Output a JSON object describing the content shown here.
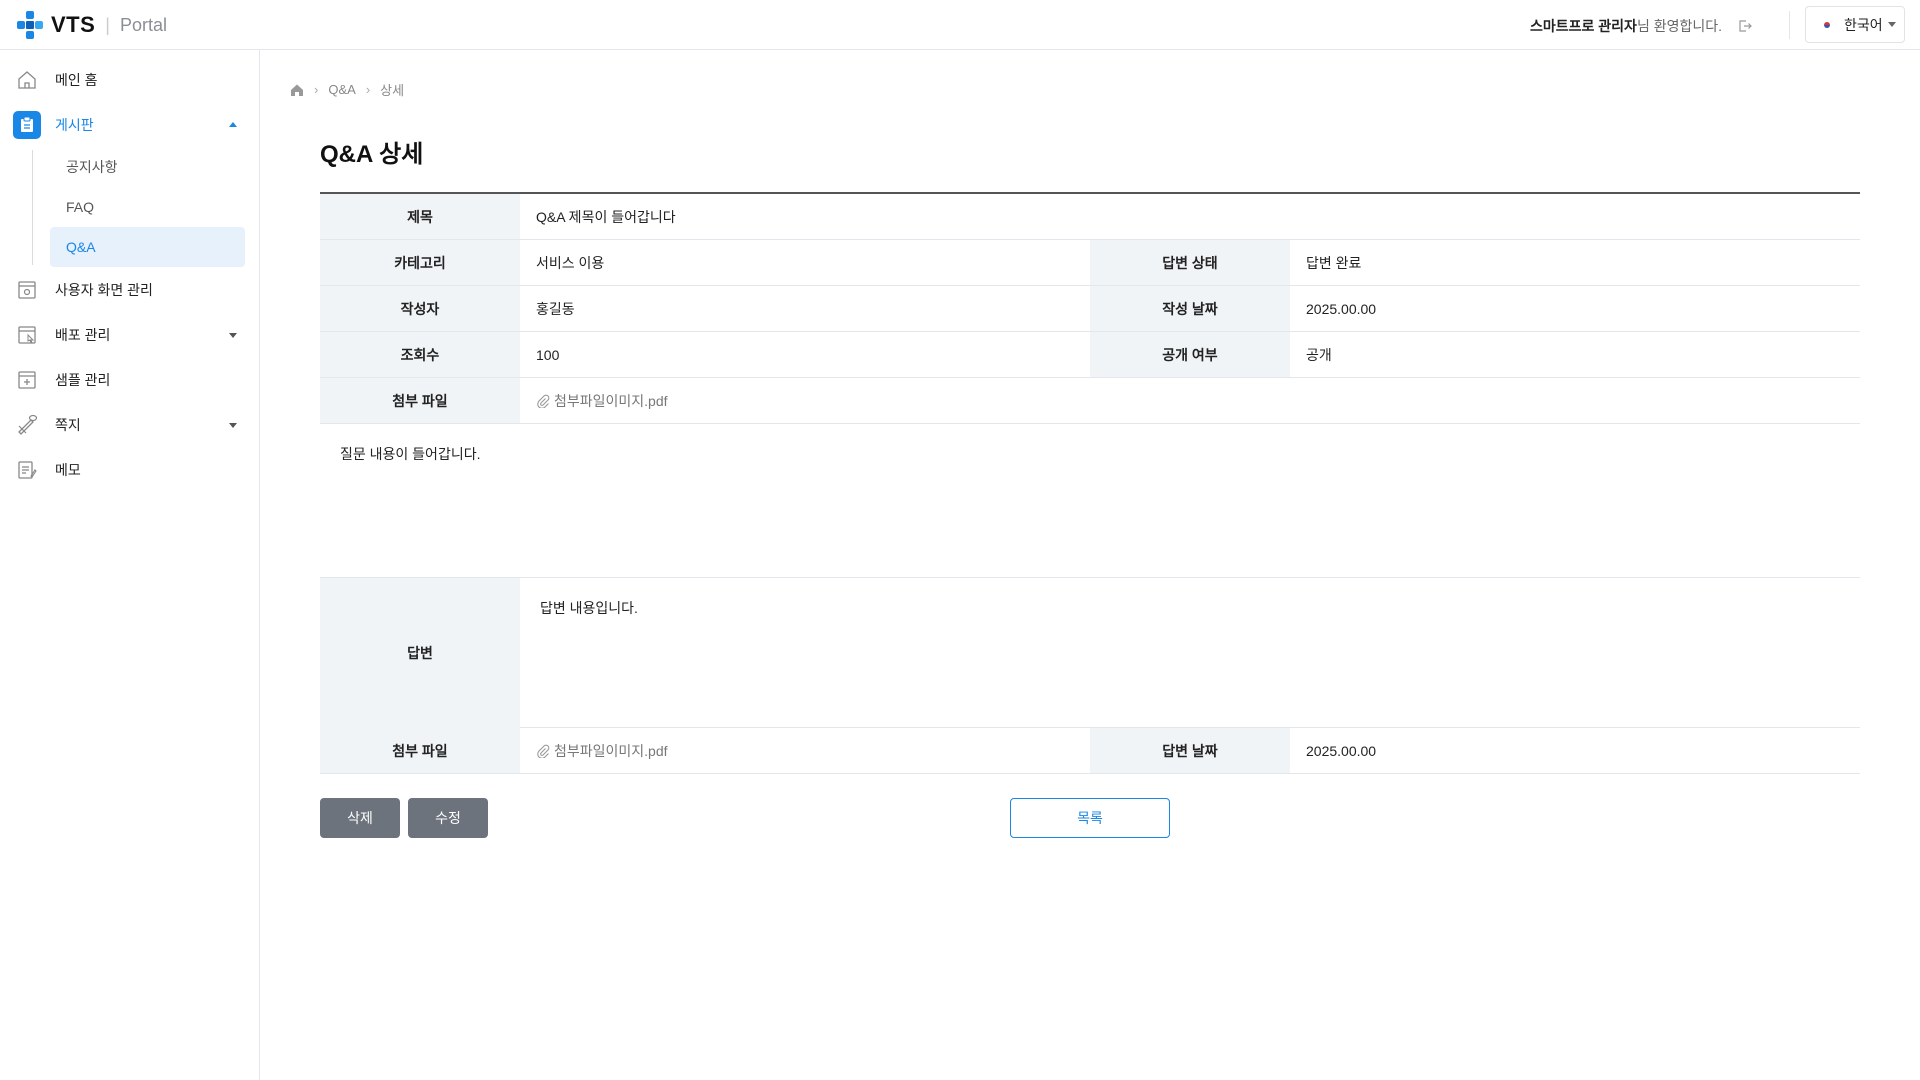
{
  "header": {
    "logo_text": "VTS",
    "logo_sep": "|",
    "logo_sub": "Portal",
    "user_name": "스마트프로 관리자",
    "welcome_suffix": "님 환영합니다.",
    "language": "한국어"
  },
  "sidebar": {
    "items": [
      {
        "label": "메인 홈",
        "icon": "home-icon"
      },
      {
        "label": "게시판",
        "icon": "board-icon"
      },
      {
        "label": "사용자 화면 관리",
        "icon": "screen-manage-icon"
      },
      {
        "label": "배포 관리",
        "icon": "deploy-icon"
      },
      {
        "label": "샘플 관리",
        "icon": "sample-icon"
      },
      {
        "label": "쪽지",
        "icon": "message-icon"
      },
      {
        "label": "메모",
        "icon": "memo-icon"
      }
    ],
    "sub_items": [
      "공지사항",
      "FAQ",
      "Q&A"
    ]
  },
  "breadcrumb": {
    "items": [
      "Q&A",
      "상세"
    ],
    "sep": "›"
  },
  "page_title": "Q&A 상세",
  "detail": {
    "title_label": "제목",
    "title_value": "Q&A 제목이 들어갑니다",
    "category_label": "카테고리",
    "category_value": "서비스 이용",
    "status_label": "답변 상태",
    "status_value": "답변 완료",
    "author_label": "작성자",
    "author_value": "홍길동",
    "date_label": "작성 날짜",
    "date_value": "2025.00.00",
    "views_label": "조회수",
    "views_value": "100",
    "public_label": "공개 여부",
    "public_value": "공개",
    "attach_label": "첨부 파일",
    "attach_value": "첨부파일이미지.pdf",
    "question": "질문 내용이 들어갑니다.",
    "answer_label": "답변",
    "answer_value": "답변 내용입니다.",
    "answer_attach_label": "첨부 파일",
    "answer_attach_value": "첨부파일이미지.pdf",
    "answer_date_label": "답변 날짜",
    "answer_date_value": "2025.00.00"
  },
  "buttons": {
    "delete": "삭제",
    "edit": "수정",
    "list": "목록"
  },
  "colors": {
    "accent": "#1a86e6",
    "gray_button": "#6c737c",
    "header_cell": "#f1f4f7"
  }
}
